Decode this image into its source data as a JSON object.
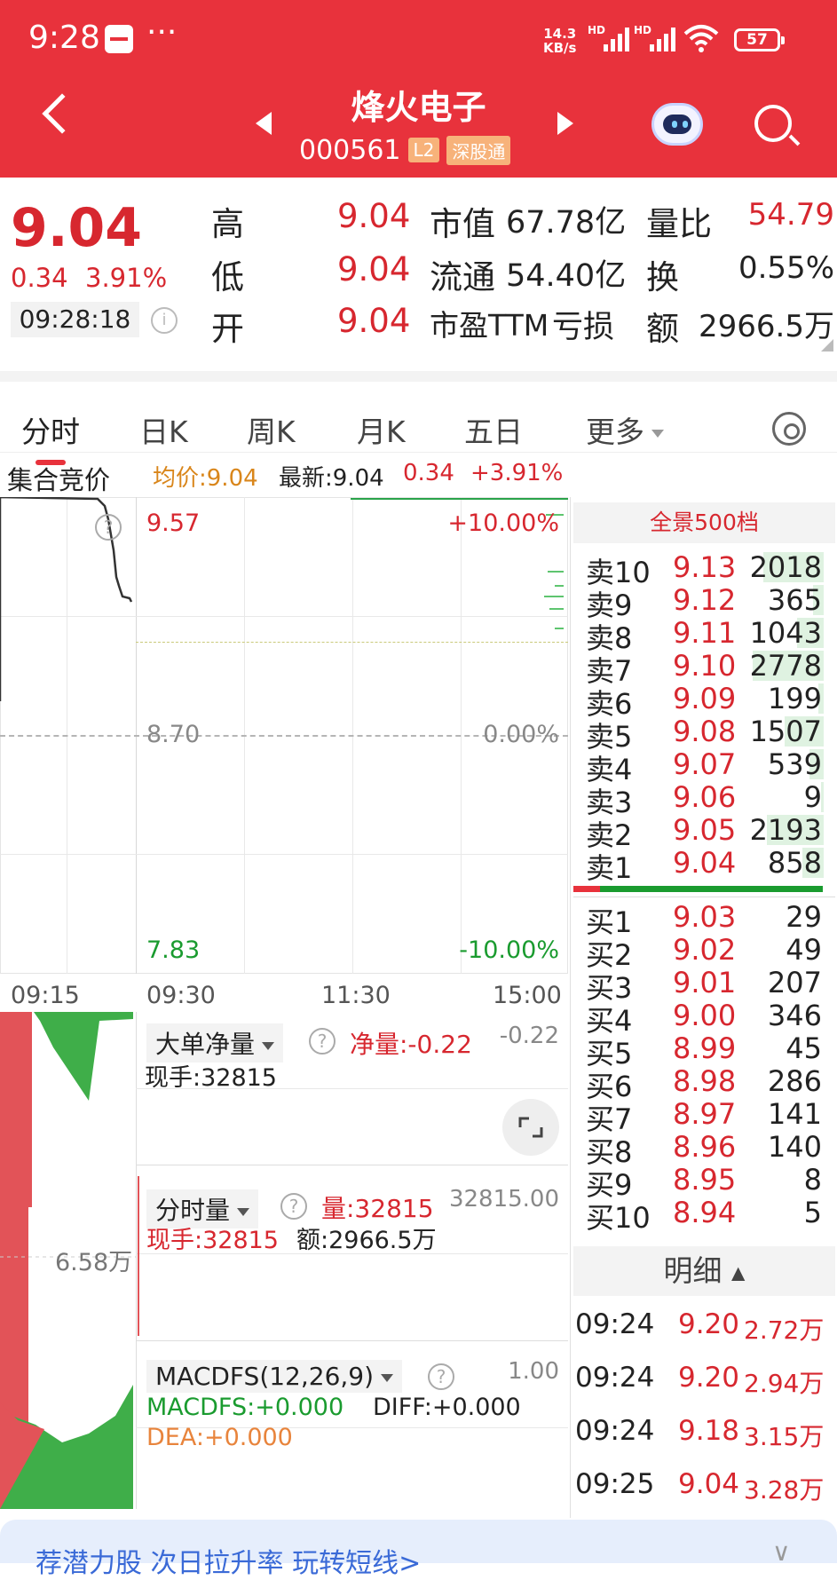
{
  "status_bar": {
    "time": "9:28",
    "dots": "···",
    "net_speed": "14.3",
    "net_unit": "KB/s",
    "hd1": "HD",
    "hd2": "HD",
    "battery": "57"
  },
  "header": {
    "stock_name": "烽火电子",
    "stock_code": "000561",
    "tag_level": "L2",
    "tag_market": "深股通"
  },
  "quote": {
    "price": "9.04",
    "change": "0.34",
    "change_pct": "3.91%",
    "time": "09:28:18",
    "high_label": "高",
    "high": "9.04",
    "low_label": "低",
    "low": "9.04",
    "open_label": "开",
    "open": "9.04",
    "mcap_label": "市值",
    "mcap": "67.78亿",
    "float_label": "流通",
    "float": "54.40亿",
    "pe_label": "市盈TTM",
    "pe": "亏损",
    "vr_label": "量比",
    "vr": "54.79",
    "turn_label": "换",
    "turn": "0.55%",
    "amt_label": "额",
    "amt": "2966.5万"
  },
  "tabs": [
    "分时",
    "日K",
    "周K",
    "月K",
    "五日",
    "更多"
  ],
  "info_bar": {
    "auction": "集合竞价",
    "avg": "均价:9.04",
    "latest": "最新:9.04",
    "chg": "0.34",
    "chg_pct": "+3.91%"
  },
  "chart": {
    "max_price": "9.57",
    "mid_price": "8.70",
    "min_price": "7.83",
    "max_pct": "+10.00%",
    "mid_pct": "0.00%",
    "min_pct": "-10.00%",
    "times": [
      "09:15",
      "09:30",
      "11:30",
      "15:00"
    ]
  },
  "order_book": {
    "header": "全景500档",
    "sells": [
      {
        "label": "卖10",
        "price": "9.13",
        "vol": "2018",
        "fill": 0.85
      },
      {
        "label": "卖9",
        "price": "9.12",
        "vol": "365",
        "fill": 0.15
      },
      {
        "label": "卖8",
        "price": "9.11",
        "vol": "1043",
        "fill": 0.38
      },
      {
        "label": "卖7",
        "price": "9.10",
        "vol": "2778",
        "fill": 1.0
      },
      {
        "label": "卖6",
        "price": "9.09",
        "vol": "199",
        "fill": 0.07
      },
      {
        "label": "卖5",
        "price": "9.08",
        "vol": "1507",
        "fill": 0.55
      },
      {
        "label": "卖4",
        "price": "9.07",
        "vol": "539",
        "fill": 0.2
      },
      {
        "label": "卖3",
        "price": "9.06",
        "vol": "9",
        "fill": 0.01
      },
      {
        "label": "卖2",
        "price": "9.05",
        "vol": "2193",
        "fill": 0.8
      },
      {
        "label": "卖1",
        "price": "9.04",
        "vol": "858",
        "fill": 0.3
      }
    ],
    "buys": [
      {
        "label": "买1",
        "price": "9.03",
        "vol": "29"
      },
      {
        "label": "买2",
        "price": "9.02",
        "vol": "49"
      },
      {
        "label": "买3",
        "price": "9.01",
        "vol": "207"
      },
      {
        "label": "买4",
        "price": "9.00",
        "vol": "346"
      },
      {
        "label": "买5",
        "price": "8.99",
        "vol": "45"
      },
      {
        "label": "买6",
        "price": "8.98",
        "vol": "286"
      },
      {
        "label": "买7",
        "price": "8.97",
        "vol": "141"
      },
      {
        "label": "买8",
        "price": "8.96",
        "vol": "140"
      },
      {
        "label": "买9",
        "price": "8.95",
        "vol": "8"
      },
      {
        "label": "买10",
        "price": "8.94",
        "vol": "5"
      }
    ]
  },
  "panels": {
    "p1_name": "大单净量",
    "p1_net": "净量:-0.22",
    "p1_val": "-0.22",
    "p1_hand": "现手:32815",
    "p2_name": "分时量",
    "p2_vol": "量:32815",
    "p2_val": "32815.00",
    "p2_hand": "现手:32815",
    "p2_amt": "额:2966.5万",
    "left_vol": "6.58万",
    "p3_name": "MACDFS(12,26,9)",
    "p3_val": "1.00",
    "p3_macd": "MACDFS:+0.000",
    "p3_diff": "DIFF:+0.000",
    "p3_dea": "DEA:+0.000"
  },
  "details": {
    "header": "明细",
    "rows": [
      {
        "time": "09:24",
        "price": "9.20",
        "amt": "2.72万"
      },
      {
        "time": "09:24",
        "price": "9.20",
        "amt": "2.94万"
      },
      {
        "time": "09:24",
        "price": "9.18",
        "amt": "3.15万"
      },
      {
        "time": "09:25",
        "price": "9.04",
        "amt": "3.28万"
      }
    ]
  },
  "banner": {
    "text": "荐潜力股 次日拉升率 玩转短线>"
  },
  "colors": {
    "brand_red": "#e8323c",
    "up": "#d7272f",
    "down": "#1a9b2f"
  }
}
